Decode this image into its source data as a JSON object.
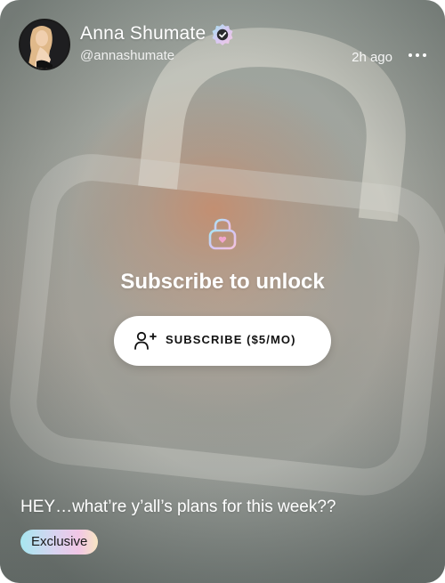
{
  "post": {
    "author": {
      "name": "Anna Shumate",
      "handle": "@annashumate",
      "verified_icon": "verified-badge-icon"
    },
    "timestamp": "2h ago",
    "more_icon": "more-horizontal-icon",
    "locked": {
      "lock_icon": "lock-heart-icon",
      "title": "Subscribe to unlock",
      "subscribe_icon": "user-plus-icon",
      "subscribe_label": "SUBSCRIBE ($5/MO)"
    },
    "caption": "HEY…what’re y’all’s plans for this week??",
    "tag": "Exclusive"
  },
  "colors": {
    "text": "#ffffff",
    "button_bg": "#ffffff",
    "button_text": "#111111",
    "tag_gradient": [
      "#a7e7f0",
      "#d9d3f0",
      "#f1c6e6",
      "#f8e6c2"
    ]
  }
}
